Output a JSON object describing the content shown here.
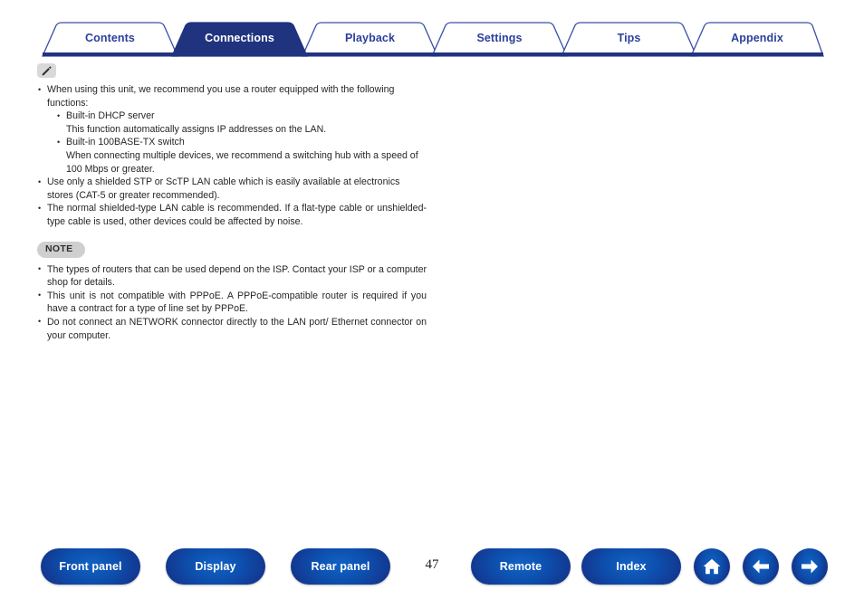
{
  "tabs": [
    {
      "label": "Contents",
      "active": false
    },
    {
      "label": "Connections",
      "active": true
    },
    {
      "label": "Playback",
      "active": false
    },
    {
      "label": "Settings",
      "active": false
    },
    {
      "label": "Tips",
      "active": false
    },
    {
      "label": "Appendix",
      "active": false
    }
  ],
  "colors": {
    "tab_navy": "#20337f",
    "tab_active_fill": "#20337f",
    "tab_text": "#2b3f9c",
    "tab_active_text": "#ffffff",
    "body_text": "#262626",
    "badge_gray": "#cfcfcf",
    "button_blue": "#0d4fae"
  },
  "content": {
    "tip_icon": "pencil-icon",
    "tip_bullets": [
      {
        "text": "When using this unit, we recommend you use a router equipped with the following functions:",
        "sub": [
          {
            "kind": "bullet",
            "text": "Built-in DHCP server"
          },
          {
            "kind": "plain",
            "text": "This function automatically assigns IP addresses on the LAN."
          },
          {
            "kind": "bullet",
            "text": "Built-in 100BASE-TX switch"
          },
          {
            "kind": "plain",
            "text": "When connecting multiple devices, we recommend a switching hub with a speed of 100 Mbps or greater."
          }
        ]
      },
      {
        "text": "Use only a shielded STP or ScTP LAN cable which is easily available at electronics stores (CAT-5 or greater recommended).",
        "sub": []
      },
      {
        "text": "The normal shielded-type LAN cable is recommended. If a flat-type cable or unshielded-type cable is used, other devices could be affected by noise.",
        "sub": [],
        "justify": true
      }
    ],
    "note_label": "NOTE",
    "note_bullets": [
      "The types of routers that can be used depend on the ISP. Contact your ISP or a computer shop for details.",
      "This unit is not compatible with PPPoE. A PPPoE-compatible router is required if you have a contract for a type of line set by PPPoE.",
      "Do not connect an NETWORK connector directly to the LAN port/ Ethernet connector on your computer."
    ]
  },
  "bottom_nav": {
    "page_number": "47",
    "buttons": [
      {
        "label": "Front panel",
        "name": "front-panel-button"
      },
      {
        "label": "Display",
        "name": "display-button"
      },
      {
        "label": "Rear panel",
        "name": "rear-panel-button"
      },
      {
        "label": "Remote",
        "name": "remote-button"
      },
      {
        "label": "Index",
        "name": "index-button"
      }
    ],
    "icon_buttons": [
      {
        "icon": "home-icon",
        "name": "home-button"
      },
      {
        "icon": "arrow-left-icon",
        "name": "previous-page-button"
      },
      {
        "icon": "arrow-right-icon",
        "name": "next-page-button"
      }
    ]
  }
}
